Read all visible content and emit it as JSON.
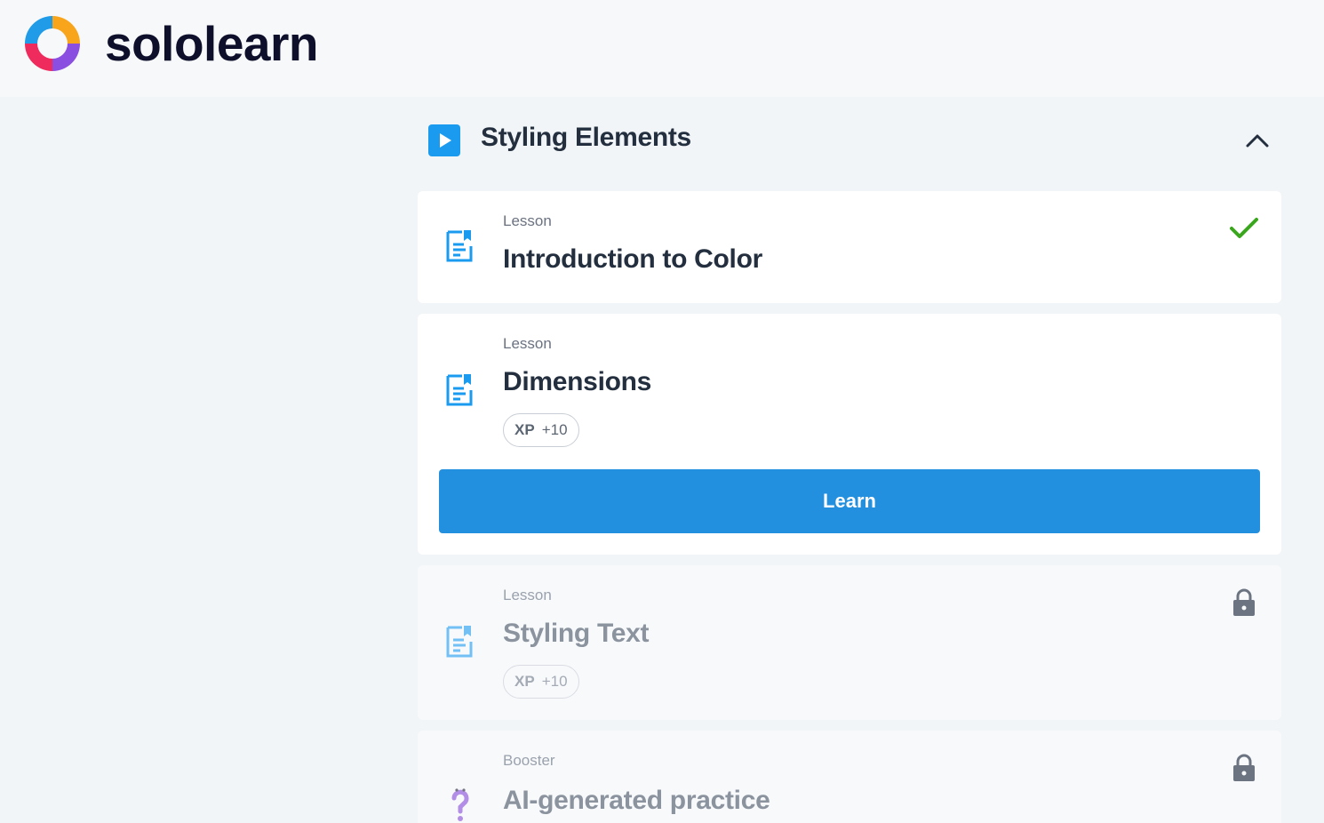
{
  "brand": {
    "name": "sololearn"
  },
  "section": {
    "title": "Styling Elements",
    "icon": "play-icon",
    "expanded": true
  },
  "items": [
    {
      "type": "Lesson",
      "title": "Introduction to Color",
      "status": "completed",
      "icon": "lesson-document-icon"
    },
    {
      "type": "Lesson",
      "title": "Dimensions",
      "xp_label": "XP",
      "xp_value": "+10",
      "status": "current",
      "icon": "lesson-document-icon",
      "button_label": "Learn"
    },
    {
      "type": "Lesson",
      "title": "Styling Text",
      "xp_label": "XP",
      "xp_value": "+10",
      "status": "locked",
      "icon": "lesson-document-icon"
    },
    {
      "type": "Booster",
      "title": "AI-generated practice",
      "status": "locked",
      "icon": "booster-question-icon"
    }
  ],
  "colors": {
    "accent": "#2390df",
    "play": "#1a9bf0",
    "check": "#3aa61e",
    "lock": "#6b7480"
  }
}
